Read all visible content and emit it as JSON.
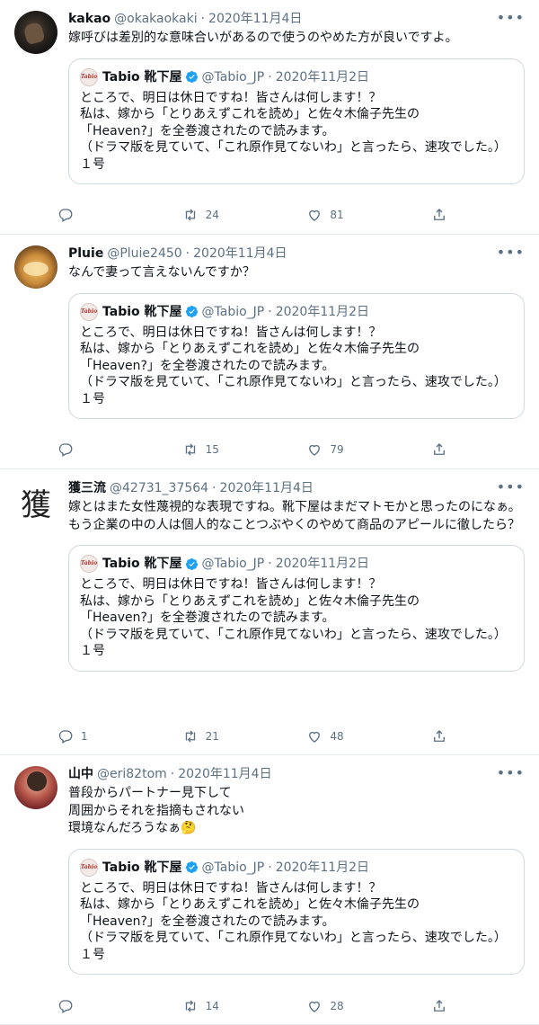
{
  "quoted": {
    "name": "Tabio 靴下屋",
    "handle": "@Tabio_JP",
    "dot": "·",
    "date": "2020年11月2日",
    "avatar_text": "Tabio",
    "text": "ところで、明日は休日ですね！皆さんは何します！？\n私は、嫁から「とりあえずこれを読め」と佐々木倫子先生の\n「Heaven?」を全巻渡されたので読みます。\n（ドラマ版を見ていて、「これ原作見てないわ」と言ったら、速攻でした。）\n１号"
  },
  "tweets": [
    {
      "name": "kakao",
      "handle": "@okakaokaki",
      "dot": "·",
      "date": "2020年11月4日",
      "text": "嫁呼びは差別的な意味合いがあるので使うのやめた方が良いですよ。",
      "replies": "",
      "retweets": "24",
      "likes": "81"
    },
    {
      "name": "Pluie",
      "handle": "@Pluie2450",
      "dot": "·",
      "date": "2020年11月4日",
      "text": "なんで妻って言えないんですか？",
      "replies": "",
      "retweets": "15",
      "likes": "79"
    },
    {
      "name": "獲三流",
      "handle": "@42731_37564",
      "dot": "·",
      "date": "2020年11月4日",
      "avatar_text": "獲",
      "text": "嫁とはまた女性蔑視的な表現ですね。靴下屋はまだマトモかと思ったのになぁ。\nもう企業の中の人は個人的なことつぶやくのやめて商品のアピールに徹したら？",
      "replies": "1",
      "retweets": "21",
      "likes": "48"
    },
    {
      "name": "山中",
      "handle": "@eri82tom",
      "dot": "·",
      "date": "2020年11月4日",
      "text": "普段からパートナー見下して\n周囲からそれを指摘もされない\n環境なんだろうなぁ🤔",
      "replies": "",
      "retweets": "14",
      "likes": "28"
    }
  ],
  "icons": {
    "more": "more-icon",
    "reply": "reply-icon",
    "retweet": "retweet-icon",
    "like": "like-icon",
    "share": "share-icon",
    "verified": "verified-badge-icon"
  },
  "colors": {
    "text": "#0f1419",
    "secondary": "#5b7083",
    "border": "#e6ecf0",
    "verified": "#1da1f2"
  }
}
